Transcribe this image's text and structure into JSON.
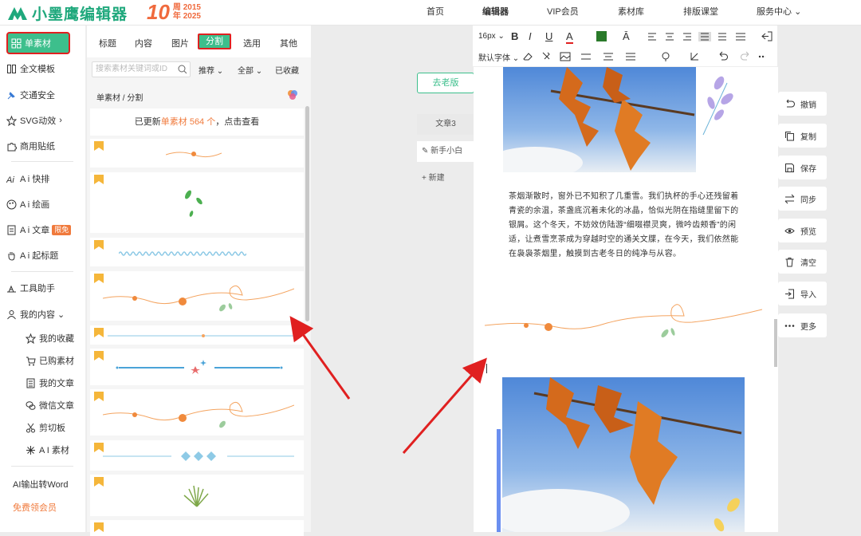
{
  "header": {
    "brand": "小墨鹰编辑器",
    "anniversary": {
      "big": "10",
      "line1": "周 2015",
      "line2": "年 2025"
    },
    "nav": [
      "首页",
      "编辑器",
      "VIP会员",
      "素材库",
      "排版课堂",
      "服务中心"
    ],
    "nav_active": "编辑器"
  },
  "sidebar": {
    "items": [
      {
        "label": "单素材",
        "icon": "grid-icon",
        "active": true
      },
      {
        "label": "全文模板",
        "icon": "template-icon"
      },
      {
        "label": "交通安全",
        "icon": "pin-icon"
      },
      {
        "label": "SVG动效",
        "icon": "star-icon",
        "suffix": "›"
      },
      {
        "label": "商用贴纸",
        "icon": "puzzle-icon"
      },
      {
        "label": "A i 快排",
        "icon": "ai-icon"
      },
      {
        "label": "A i 绘画",
        "icon": "palette-icon"
      },
      {
        "label": "A i 文章",
        "icon": "doc-icon",
        "badge": "限免"
      },
      {
        "label": "A i 起标题",
        "icon": "hand-icon"
      },
      {
        "label": "工具助手",
        "icon": "tools-icon"
      },
      {
        "label": "我的内容",
        "icon": "user-icon",
        "suffix": "⌄"
      }
    ],
    "sub_items": [
      {
        "label": "我的收藏",
        "icon": "star-outline-icon"
      },
      {
        "label": "已购素材",
        "icon": "cart-icon"
      },
      {
        "label": "我的文章",
        "icon": "article-icon"
      },
      {
        "label": "微信文章",
        "icon": "wechat-icon"
      },
      {
        "label": "剪切板",
        "icon": "scissors-icon"
      },
      {
        "label": "A I 素材",
        "icon": "sparkle-icon"
      }
    ],
    "footer": [
      {
        "label": "AI输出转Word"
      },
      {
        "label": "免费领会员"
      }
    ]
  },
  "panel": {
    "tabs": [
      "标题",
      "内容",
      "图片",
      "分割",
      "选用",
      "其他"
    ],
    "active_tab": "分割",
    "search_placeholder": "搜索素材关键词或ID",
    "filters": [
      "推荐 ⌄",
      "全部 ⌄",
      "已收藏"
    ],
    "breadcrumb": "单素材 / 分割",
    "notice": {
      "pre": "已更新",
      "hl1": "单素材 564 个",
      "post": "，点击查看"
    }
  },
  "editor": {
    "old_version_btn": "去老版",
    "articles": [
      "文章3",
      "新手小白",
      "+ 新建"
    ],
    "toolbar": {
      "font_size": "16px ⌄",
      "font_family": "默认字体 ⌄",
      "bold": "B",
      "italic": "I",
      "underline": "U"
    },
    "paragraph": "茶烟渐散时，窗外已不知积了几重雪。我们执杯的手心还残留着青瓷的余温，茶盏底沉着未化的冰晶，恰似光阴在指缝里留下的银屑。这个冬天，不妨效仿陆游“细啜襟灵爽，微吟齿颊香”的闲适，让煮雪烹茶成为穿越时空的通关文牒，在今天，我们依然能在袅袅茶烟里，触摸到古老冬日的纯净与从容。"
  },
  "side_actions": [
    "撤销",
    "复制",
    "保存",
    "同步",
    "预览",
    "清空",
    "导入",
    "更多"
  ],
  "colors": {
    "accent": "#3dbf8c",
    "highlight_border": "#e02020",
    "orange": "#f07a3c"
  }
}
